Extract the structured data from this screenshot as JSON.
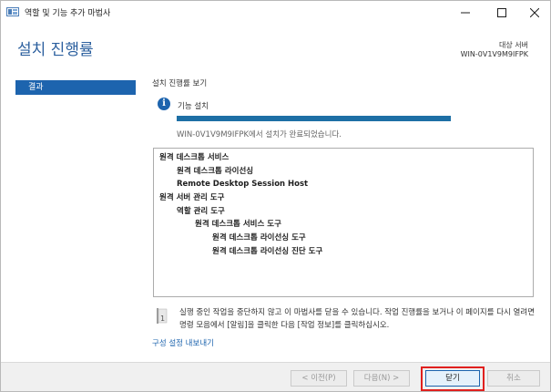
{
  "window": {
    "title": "역할 및 기능 추가 마법사"
  },
  "header": {
    "title": "설치 진행률",
    "target_label": "대상 서버",
    "target_server": "WIN-0V1V9M9IFPK"
  },
  "nav": {
    "items": [
      {
        "label": "결과",
        "selected": true
      }
    ]
  },
  "content": {
    "section_title": "설치 진행률 보기",
    "feature_label": "기능 설치",
    "progress": 1.0,
    "complete_text": "WIN-0V1V9M9IFPK에서 설치가 완료되었습니다.",
    "results": [
      {
        "text": "원격 데스크톱 서비스",
        "level": 0
      },
      {
        "text": "원격 데스크톱 라이선싱",
        "level": 1
      },
      {
        "text": "Remote Desktop Session Host",
        "level": 1
      },
      {
        "text": "원격 서버 관리 도구",
        "level": 0
      },
      {
        "text": "역할 관리 도구",
        "level": 1
      },
      {
        "text": "원격 데스크톱 서비스 도구",
        "level": 2
      },
      {
        "text": "원격 데스크톱 라이선싱 도구",
        "level": 3
      },
      {
        "text": "원격 데스크톱 라이선싱 진단 도구",
        "level": 3
      }
    ],
    "note_text": "실행 중인 작업을 중단하지 않고 이 마법사를 닫을 수 있습니다. 작업 진행률을 보거나 이 페이지를 다시 열려면 명령 모음에서 [알림]을 클릭한 다음 [작업 정보]를 클릭하십시오.",
    "export_link": "구성 설정 내보내기"
  },
  "footer": {
    "prev_label": "< 이전(P)",
    "next_label": "다음(N) >",
    "close_label": "닫기",
    "cancel_label": "취소"
  },
  "colors": {
    "accent": "#1d64ae",
    "highlight": "#e0201e"
  }
}
